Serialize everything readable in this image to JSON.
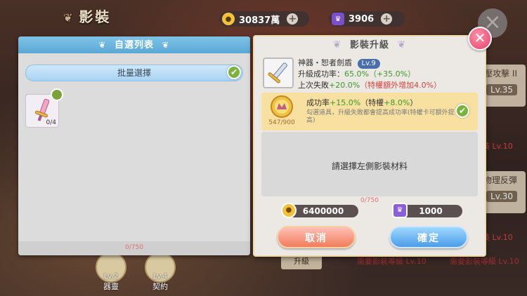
{
  "background": {
    "title": "影裝",
    "gold": "30837萬",
    "gems": "3906",
    "side_cards": [
      {
        "name": "壓攻擊 II",
        "level": "Lv.35"
      },
      {
        "name": "物理反彈",
        "level": "Lv.30"
      }
    ],
    "side_red_texts": [
      "裝 Lv.10",
      "裝 Lv.10"
    ],
    "upgrade_button": "升級",
    "red_under": [
      "需要影裝等級 Lv.10",
      "需要影裝等級 Lv.10"
    ],
    "skills": [
      {
        "level": "Lv.2",
        "label": "器靈"
      },
      {
        "level": "Lv.4",
        "label": "契約"
      }
    ]
  },
  "left_panel": {
    "title": "自選列表",
    "batch_select": "批量選擇",
    "item_count": "0/4",
    "capacity": "0/750"
  },
  "right_panel": {
    "title": "影裝升級",
    "item_name": "神器・恕者劍盾",
    "item_level": "Lv.9",
    "success_label": "升級成功率：",
    "success_value": "65.0%",
    "success_bonus": "（+35.0%）",
    "fail_label": "上次失敗",
    "fail_value": "+20.0%",
    "fail_extra": "（特權額外增加4.0%）",
    "medal_progress": "547/900",
    "rate_label": "成功率",
    "rate_value": "+15.0%",
    "rate_priv_label": "（特權",
    "rate_priv_value": "+8.0%",
    "rate_close": "）",
    "desc": "勾選道具，升級失敗都會提高成功率(特權卡可額外提高)",
    "materials_placeholder": "請選擇左側影裝材料",
    "materials_count": "0/750",
    "cost_gold": "6400000",
    "cost_gem": "1000",
    "cancel": "取消",
    "confirm": "確定"
  },
  "colors": {
    "success": "#3a9a2a",
    "fail": "#d84040",
    "cancel": "#f07c5a",
    "confirm": "#4b9ce8"
  }
}
